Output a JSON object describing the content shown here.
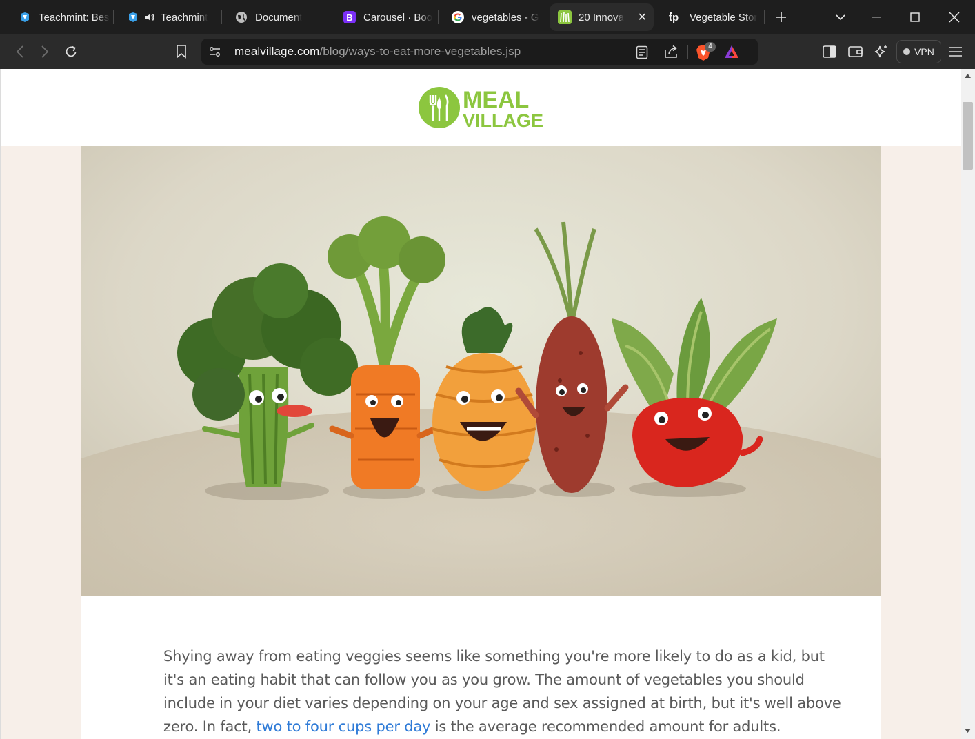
{
  "browser": {
    "tabs": [
      {
        "title": "Teachmint: Bes",
        "favicon": "teachmint-icon",
        "active": false,
        "audio": false
      },
      {
        "title": "Teachmint",
        "favicon": "teachmint-icon",
        "active": false,
        "audio": true
      },
      {
        "title": "Document",
        "favicon": "globe-icon",
        "active": false,
        "audio": false
      },
      {
        "title": "Carousel · Boo",
        "favicon": "bootstrap-icon",
        "active": false,
        "audio": false
      },
      {
        "title": "vegetables - G",
        "favicon": "google-icon",
        "active": false,
        "audio": false
      },
      {
        "title": "20 Innova",
        "favicon": "mealvillage-icon",
        "active": true,
        "audio": false
      },
      {
        "title": "Vegetable Stor",
        "favicon": "tp-icon",
        "active": false,
        "audio": false
      }
    ],
    "url": {
      "host": "mealvillage.com",
      "path": "/blog/ways-to-eat-more-vegetables.jsp"
    },
    "shield_badge": "4",
    "vpn_label": "VPN",
    "colors": {
      "tabstrip": "#1e1e1e",
      "toolbar": "#2b2b2b",
      "urlbar": "#1b1b1b"
    }
  },
  "site": {
    "logo": {
      "line1": "MEAL",
      "line2": "VILLAGE",
      "color": "#8cc63f"
    }
  },
  "hero_image": {
    "alt": "Cartoon vegetables: broccoli, carrot, squash, sweet potato and a red beet with leaves, smiling"
  },
  "article": {
    "para_part1": "Shying away from eating veggies seems like something you're more likely to do as a kid, but it's an eating habit that can follow you as you grow. The amount of vegetables you should include in your diet varies depending on your age and sex assigned at birth, but it's well above zero. In fact, ",
    "link_text": "two to four cups per day",
    "para_part2": " is the average recommended amount for adults. However, according to",
    "text_color": "#5a5a5a",
    "link_color": "#2f7bd7"
  }
}
